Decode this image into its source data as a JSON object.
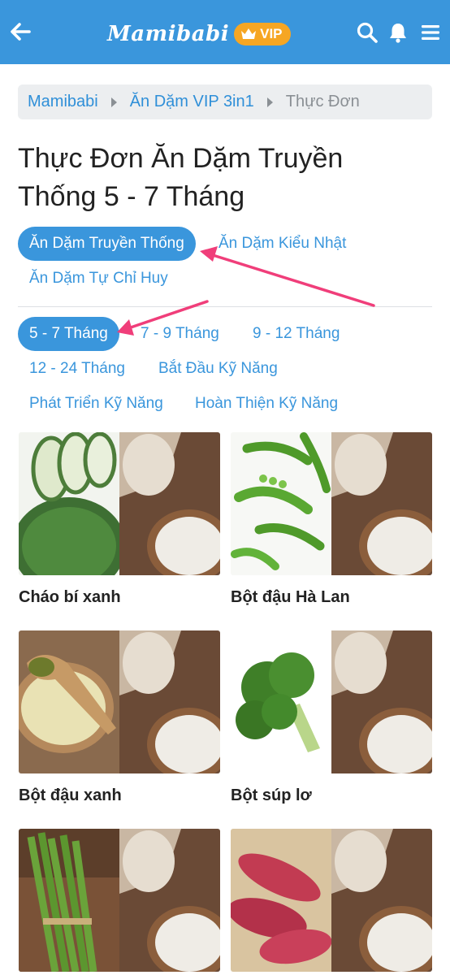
{
  "header": {
    "logo_text": "Mamibabi",
    "vip_label": "VIP",
    "background_color": "#3a96dc",
    "icons": [
      "back-arrow-icon",
      "crown-icon",
      "search-icon",
      "bell-icon",
      "hamburger-menu-icon"
    ]
  },
  "breadcrumb": {
    "items": [
      "Mamibabi",
      "Ăn Dặm VIP 3in1",
      "Thực Đơn"
    ]
  },
  "page": {
    "title": "Thực Đơn Ăn Dặm Truyền Thống 5 - 7 Tháng"
  },
  "method_tabs": {
    "items": [
      "Ăn Dặm Truyền Thống",
      "Ăn Dặm Kiểu Nhật",
      "Ăn Dặm Tự Chỉ Huy"
    ],
    "active": "Ăn Dặm Truyền Thống"
  },
  "age_tabs": {
    "items": [
      "5 - 7 Tháng",
      "7 - 9 Tháng",
      "9 - 12 Tháng",
      "12 - 24 Tháng",
      "Bắt Đầu Kỹ Năng",
      "Phát Triển Kỹ Năng",
      "Hoàn Thiện Kỹ Năng"
    ],
    "active": "5 - 7 Tháng"
  },
  "recipes": [
    {
      "title": "Cháo bí xanh",
      "image": "winter-melon-and-rice-flour-photo"
    },
    {
      "title": "Bột đậu Hà Lan",
      "image": "green-peas-and-rice-flour-photo"
    },
    {
      "title": "Bột đậu xanh",
      "image": "mung-bean-flour-and-rice-flour-photo"
    },
    {
      "title": "Bột súp lơ",
      "image": "broccoli-and-rice-flour-photo"
    },
    {
      "title": "",
      "image": "asparagus-and-rice-flour-photo"
    },
    {
      "title": "",
      "image": "sweet-potato-and-rice-flour-photo"
    }
  ],
  "colors": {
    "accent": "#3a96dc",
    "vip_badge": "#f6a623",
    "annotation_arrow": "#f03e7a"
  }
}
